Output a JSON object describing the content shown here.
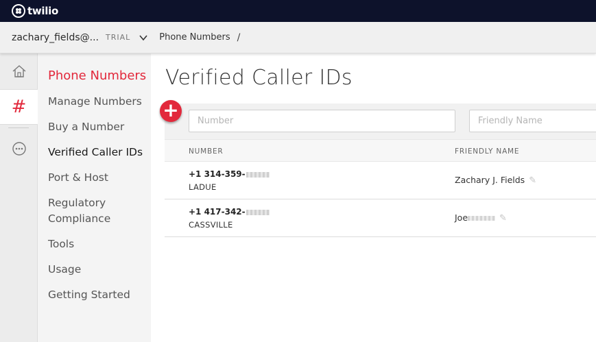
{
  "brand": {
    "name": "twilio"
  },
  "breadcrumb": {
    "account": "zachary_fields@...",
    "trial_badge": "TRIAL",
    "item": "Phone Numbers",
    "separator": "/"
  },
  "rail": {
    "items": [
      {
        "icon": "home-icon"
      },
      {
        "icon": "hash-icon",
        "label": "#"
      },
      {
        "icon": "more-icon"
      }
    ]
  },
  "sidenav": {
    "title": "Phone Numbers",
    "items": [
      {
        "label": "Manage Numbers"
      },
      {
        "label": "Buy a Number"
      },
      {
        "label": "Verified Caller IDs"
      },
      {
        "label": "Port & Host"
      },
      {
        "label": "Regulatory Compliance"
      },
      {
        "label": "Tools"
      },
      {
        "label": "Usage"
      },
      {
        "label": "Getting Started"
      }
    ]
  },
  "page": {
    "title": "Verified Caller IDs",
    "add_button": "+",
    "filters": {
      "number_placeholder": "Number",
      "friendly_placeholder": "Friendly Name"
    },
    "table": {
      "columns": [
        "NUMBER",
        "FRIENDLY NAME"
      ],
      "rows": [
        {
          "number": "+1 314-359-",
          "city": "LADUE",
          "friendly_name": "Zachary J. Fields"
        },
        {
          "number": "+1 417-342-",
          "city": "CASSVILLE",
          "friendly_name": "Joe"
        }
      ]
    }
  },
  "colors": {
    "accent": "#e2283b",
    "topbar": "#0d122b"
  }
}
